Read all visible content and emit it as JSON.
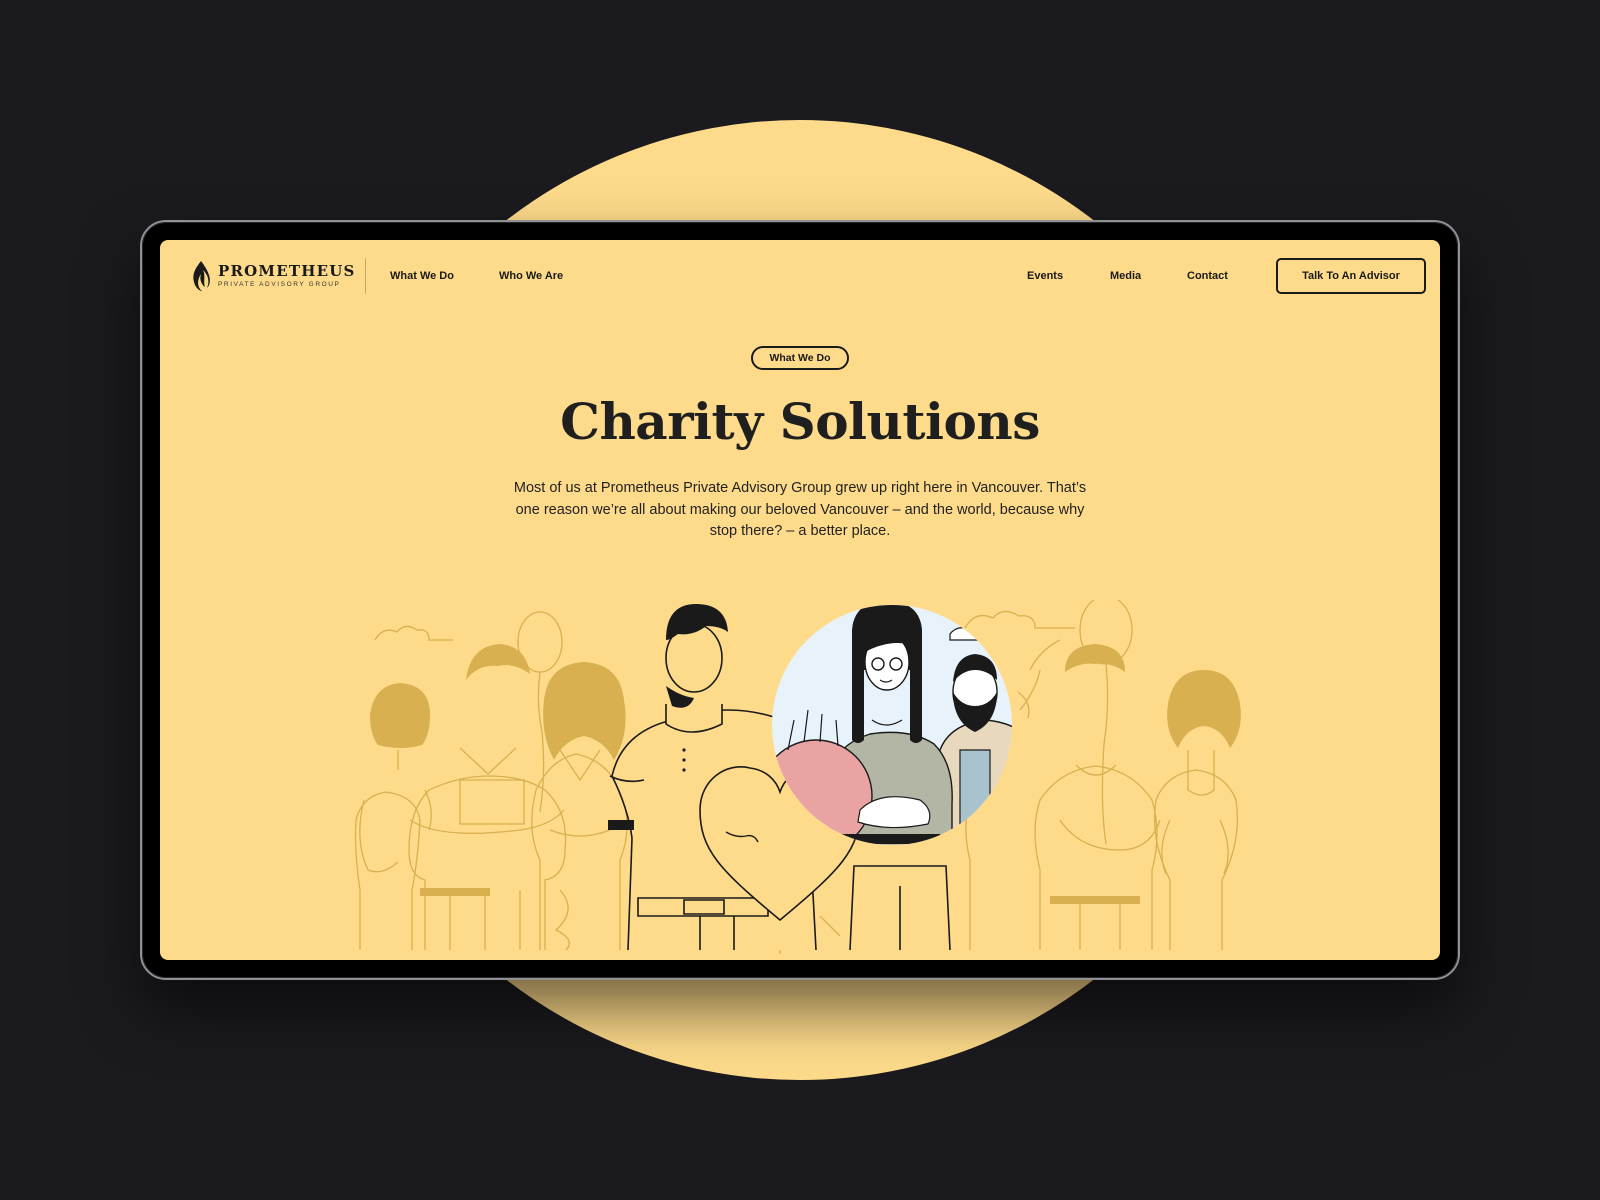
{
  "brand": {
    "name": "PROMETHEUS",
    "tagline": "PRIVATE ADVISORY GROUP"
  },
  "nav": {
    "left": [
      {
        "label": "What We Do"
      },
      {
        "label": "Who We Are"
      }
    ],
    "right": [
      {
        "label": "Events"
      },
      {
        "label": "Media"
      },
      {
        "label": "Contact"
      }
    ],
    "cta_label": "Talk To An Advisor"
  },
  "hero": {
    "eyebrow": "What We Do",
    "title": "Charity Solutions",
    "description": "Most of us at Prometheus Private Advisory Group grew up right here in Vancouver. That’s one reason we’re all about making our beloved Vancouver – and the world, because why stop there? – a better place."
  },
  "colors": {
    "page_bg": "#1b1a1f",
    "accent_yellow": "#fedb8b",
    "ink": "#1a1a1a",
    "muted_figure": "#d9b04f",
    "heart_pink": "#e9a3a3",
    "circle_sky": "#e8f2fa"
  }
}
